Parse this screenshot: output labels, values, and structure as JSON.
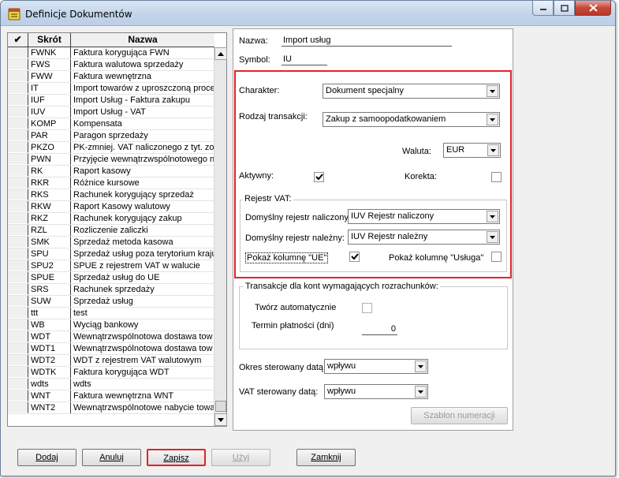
{
  "window": {
    "title": "Definicje Dokumentów"
  },
  "list": {
    "headers": {
      "check": "✔",
      "code": "Skrót",
      "name": "Nazwa"
    },
    "rows": [
      [
        "FWNK",
        "Faktura korygująca FWN"
      ],
      [
        "FWS",
        "Faktura walutowa sprzedaży"
      ],
      [
        "FWW",
        "Faktura wewnętrzna"
      ],
      [
        "IT",
        "Import towarów z uproszczoną proce"
      ],
      [
        "IUF",
        "Import Usług - Faktura zakupu"
      ],
      [
        "IUV",
        "Import Usług - VAT"
      ],
      [
        "KOMP",
        "Kompensata"
      ],
      [
        "PAR",
        "Paragon sprzedaży"
      ],
      [
        "PKZO",
        "PK-zmniej. VAT naliczonego z tyt. zob"
      ],
      [
        "PWN",
        "Przyjęcie wewnątrzwspólnotowego n"
      ],
      [
        "RK",
        "Raport kasowy"
      ],
      [
        "RKR",
        "Różnice kursowe"
      ],
      [
        "RKS",
        "Rachunek korygujący sprzedaż"
      ],
      [
        "RKW",
        "Raport Kasowy walutowy"
      ],
      [
        "RKZ",
        "Rachunek korygujący zakup"
      ],
      [
        "RZL",
        "Rozliczenie zaliczki"
      ],
      [
        "SMK",
        "Sprzedaż metoda kasowa"
      ],
      [
        "SPU",
        "Sprzedaż usług poza terytorium kraju"
      ],
      [
        "SPU2",
        "SPUE z rejestrem VAT w walucie"
      ],
      [
        "SPUE",
        "Sprzedaż usług do UE"
      ],
      [
        "SRS",
        "Rachunek sprzedaży"
      ],
      [
        "SUW",
        "Sprzedaż usług"
      ],
      [
        "ttt",
        "test"
      ],
      [
        "WB",
        "Wyciąg bankowy"
      ],
      [
        "WDT",
        "Wewnątrzwspólnotowa dostawa tow"
      ],
      [
        "WDT1",
        "Wewnątrzwspólnotowa dostawa tow"
      ],
      [
        "WDT2",
        "WDT z rejestrem VAT walutowym"
      ],
      [
        "WDTK",
        "Faktura korygująca WDT"
      ],
      [
        "wdts",
        "wdts"
      ],
      [
        "WNT",
        "Faktura wewnętrzna WNT"
      ],
      [
        "WNT2",
        "Wewnątrzwspólnotowe nabycie towa"
      ]
    ]
  },
  "form": {
    "nazwa_label": "Nazwa:",
    "nazwa_value": "Import usług",
    "symbol_label": "Symbol:",
    "symbol_value": "IU",
    "charakter_label": "Charakter:",
    "charakter_value": "Dokument specjalny",
    "rodzaj_label": "Rodzaj transakcji:",
    "rodzaj_value": "Zakup z samoopodatkowaniem",
    "waluta_label": "Waluta:",
    "waluta_value": "EUR",
    "aktywny_label": "Aktywny:",
    "aktywny_checked": true,
    "korekta_label": "Korekta:",
    "korekta_checked": false,
    "rejestr_title": "Rejestr VAT:",
    "naliczony_label": "Domyślny rejestr naliczony:",
    "naliczony_value": "IUV Rejestr naliczony",
    "nalezny_label": "Domyślny rejestr należny:",
    "nalezny_value": "IUV Rejestr należny",
    "ue_label": "Pokaż kolumnę \"UE\"",
    "ue_checked": true,
    "usluga_label": "Pokaż kolumnę \"Usługa\"",
    "usluga_checked": false,
    "trans_title": "Transakcje dla kont wymagających rozrachunków:",
    "tworz_label": "Twórz automatycznie",
    "termin_label": "Termin płatności (dni)",
    "termin_value": "0",
    "okres_label": "Okres sterowany datą:",
    "okres_value": "wpływu",
    "vat_label": "VAT sterowany datą:",
    "vat_value": "wpływu",
    "szablon_label": "Szablon numeracji"
  },
  "buttons": {
    "dodaj": "Dodaj",
    "anuluj": "Anuluj",
    "zapisz": "Zapisz",
    "uzyj": "Użyj",
    "zamknij": "Zamknij"
  },
  "colors": {
    "highlight": "#e1232b",
    "titlebar": "#c3d4ea"
  }
}
